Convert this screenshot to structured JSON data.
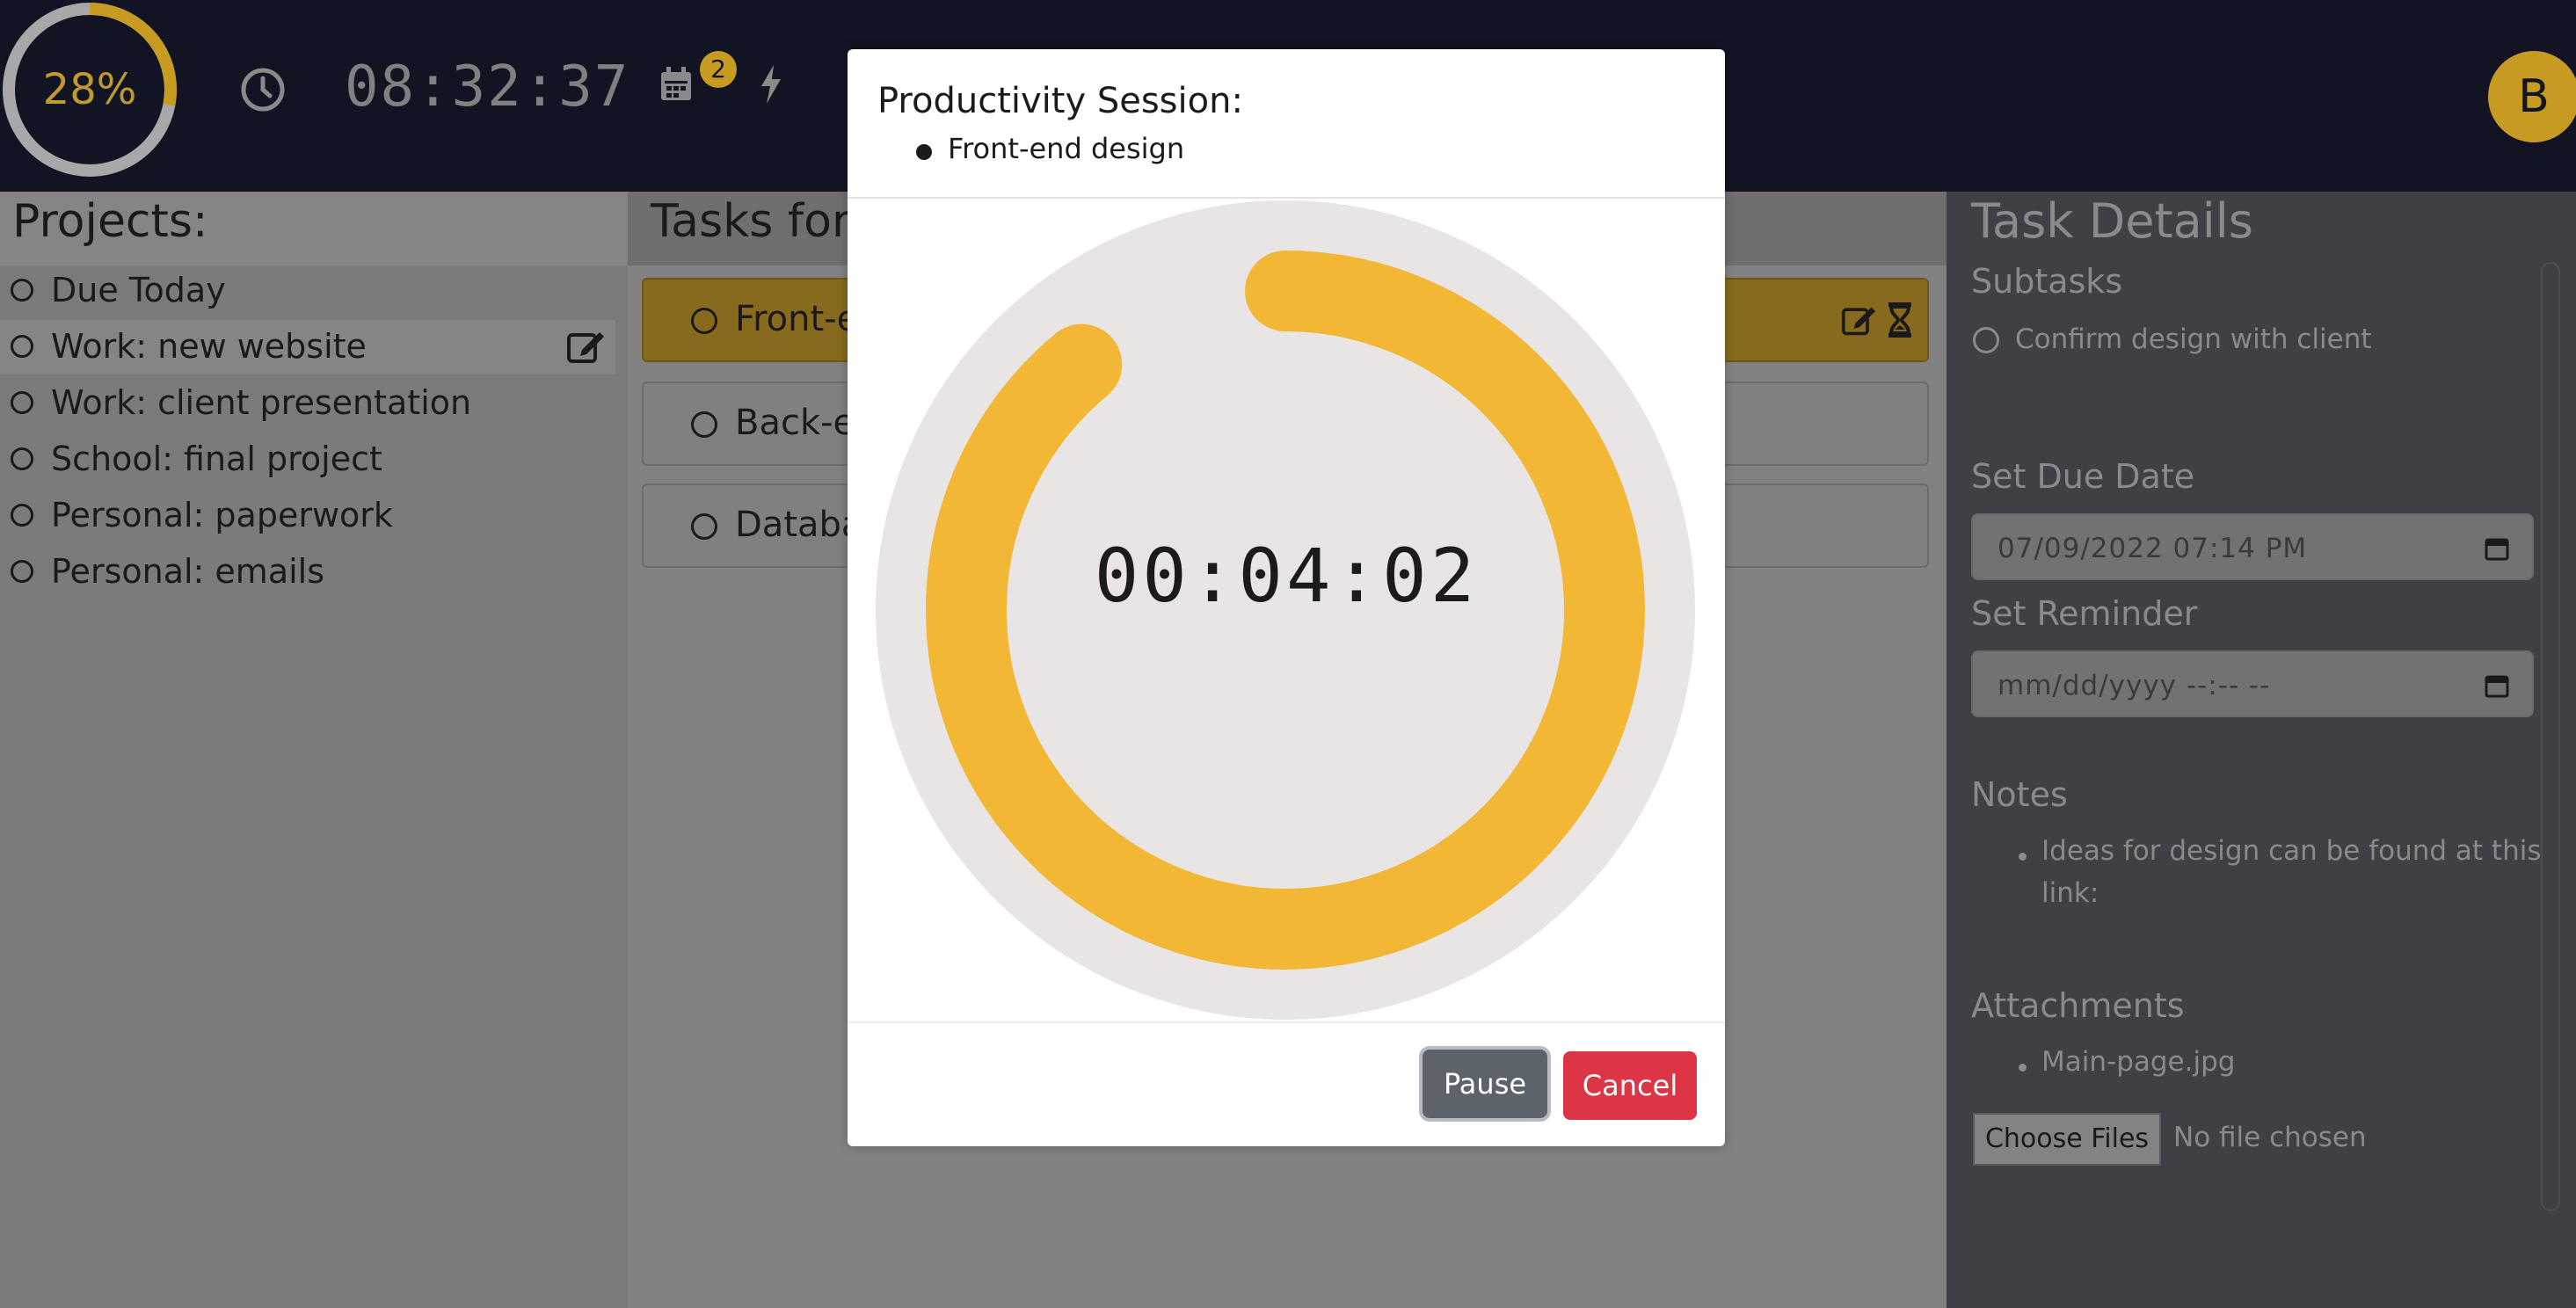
{
  "topbar": {
    "progress_percent": 28,
    "progress_label": "28%",
    "time": "08:32:37",
    "calendar_badge": "2",
    "avatar_initial": "B"
  },
  "projects": {
    "title": "Projects:",
    "items": [
      {
        "label": "Due Today"
      },
      {
        "label": "Work: new website"
      },
      {
        "label": "Work: client presentation"
      },
      {
        "label": "School: final project"
      },
      {
        "label": "Personal: paperwork"
      },
      {
        "label": "Personal: emails"
      }
    ]
  },
  "tasks": {
    "title": "Tasks for",
    "items": [
      {
        "label": "Front-e"
      },
      {
        "label": "Back-er"
      },
      {
        "label": "Databas"
      }
    ]
  },
  "details": {
    "title": "Task Details",
    "subtasks_heading": "Subtasks",
    "subtask": "Confirm design with client",
    "due_heading": "Set Due Date",
    "due_value": "07/09/2022 07:14 PM",
    "reminder_heading": "Set Reminder",
    "reminder_placeholder": "mm/dd/yyyy --:-- --",
    "notes_heading": "Notes",
    "note_line1": "Ideas for design can be found at this",
    "note_line2": "link:",
    "attachments_heading": "Attachments",
    "attachment": "Main-page.jpg",
    "choose_files_label": "Choose Files",
    "no_file_text": "No file chosen"
  },
  "modal": {
    "title": "Productivity Session:",
    "task": "Front-end design",
    "timer": "00:04:02",
    "timer_progress_fraction": 0.93,
    "pause_label": "Pause",
    "cancel_label": "Cancel"
  },
  "colors": {
    "accent": "#f2b735",
    "topbar_bg": "#131423",
    "cancel": "#dc3545",
    "pause": "#5c636a"
  }
}
